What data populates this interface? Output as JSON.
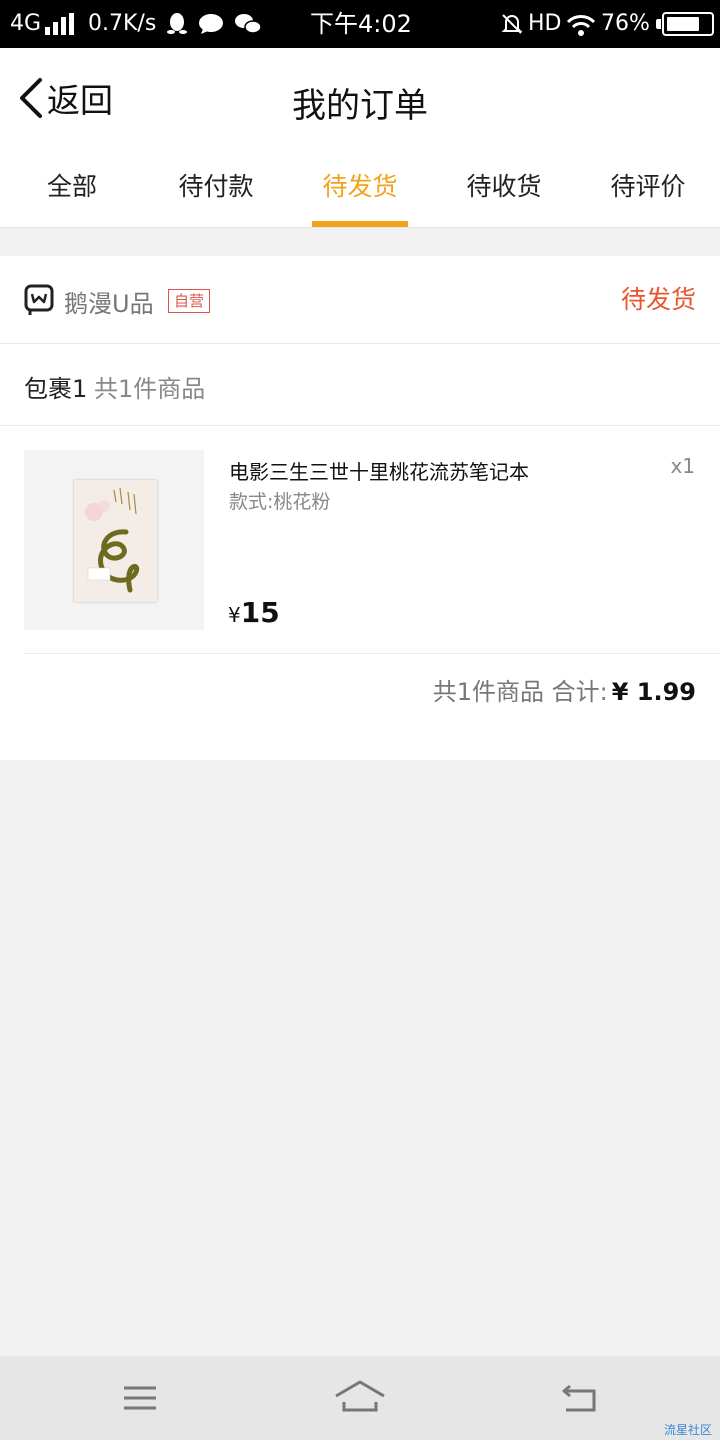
{
  "status_bar": {
    "network": "4G",
    "speed": "0.7K/s",
    "time": "下午4:02",
    "hd": "HD",
    "battery": "76%",
    "battery_level": 0.76,
    "icons": [
      "qq-icon",
      "chat-bubble-icon",
      "wechat-icon",
      "mute-icon",
      "wifi-icon",
      "battery-icon"
    ]
  },
  "header": {
    "back_label": "返回",
    "title": "我的订单"
  },
  "tabs": [
    {
      "label": "全部",
      "active": false
    },
    {
      "label": "待付款",
      "active": false
    },
    {
      "label": "待发货",
      "active": true
    },
    {
      "label": "待收货",
      "active": false
    },
    {
      "label": "待评价",
      "active": false
    }
  ],
  "order": {
    "shop_name": "鹅漫U品",
    "self_badge": "自营",
    "status": "待发货",
    "package_label": "包裹1",
    "package_count": "共1件商品",
    "item": {
      "name": "电影三生三世十里桃花流苏笔记本",
      "spec": "款式:桃花粉",
      "qty": "x1",
      "currency": "¥",
      "price": "15"
    },
    "summary_text": "共1件商品 合计:",
    "total": "¥ 1.99"
  },
  "navbar": {
    "icons": [
      "menu-icon",
      "home-icon",
      "back-nav-icon"
    ]
  },
  "watermark": "流星社区",
  "colors": {
    "accent": "#f2a31b",
    "status_red": "#e8562f",
    "badge_red": "#e0554a"
  }
}
